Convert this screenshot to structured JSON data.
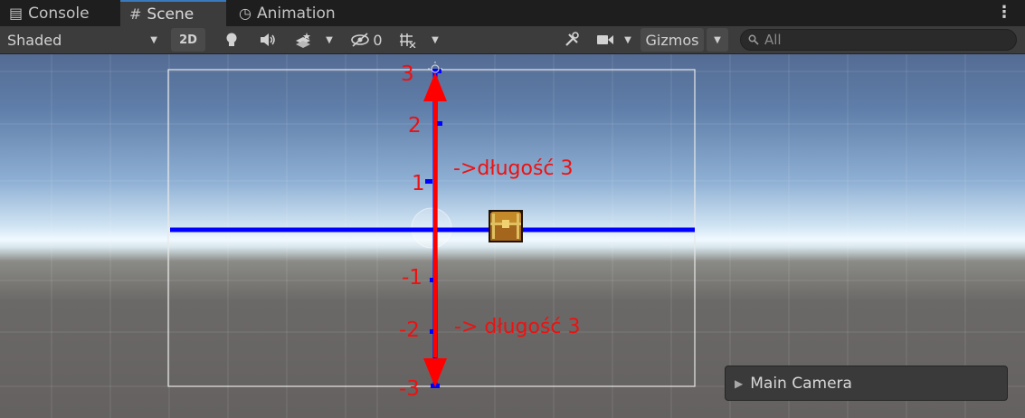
{
  "tabs": [
    {
      "label": "Console",
      "icon": "console-icon"
    },
    {
      "label": "Scene",
      "icon": "grid-icon"
    },
    {
      "label": "Animation",
      "icon": "clock-icon"
    }
  ],
  "toolbar": {
    "draw_mode": "Shaded",
    "mode_2d": "2D",
    "hidden_count": "0",
    "gizmos_label": "Gizmos",
    "search_placeholder": "All"
  },
  "annotations": {
    "y_labels": [
      "3",
      "2",
      "1",
      "-1",
      "-2",
      "-3"
    ],
    "upper_note": "->długość 3",
    "lower_note": "-> długość 3"
  },
  "camera_preview": {
    "label": "Main Camera"
  },
  "colors": {
    "axis_blue": "#0000ff",
    "arrow_red": "#ff0000",
    "annotation_red": "#ee1111",
    "active_tab_accent": "#3a79bb"
  }
}
